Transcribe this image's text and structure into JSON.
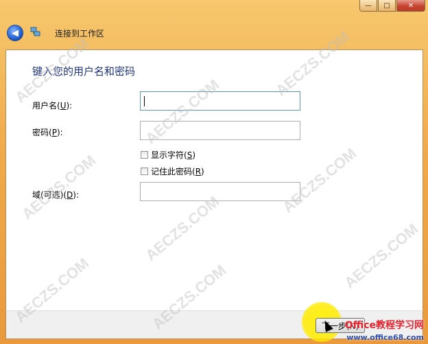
{
  "window": {
    "title_buttons": {
      "minimize": "—",
      "maximize": "□",
      "close": "✕"
    },
    "nav_title": "连接到工作区"
  },
  "form": {
    "heading": "键入您的用户名和密码",
    "username_label": "用户名(",
    "username_key": "U",
    "username_suffix": "):",
    "password_label": "密码(",
    "password_key": "P",
    "password_suffix": "):",
    "show_chars_label": "显示字符(",
    "show_chars_key": "S",
    "show_chars_suffix": ")",
    "remember_label": "记住此密码(",
    "remember_key": "R",
    "remember_suffix": ")",
    "domain_label": "域(可选)(",
    "domain_key": "D",
    "domain_suffix": "):",
    "username_value": "",
    "password_value": "",
    "domain_value": ""
  },
  "footer": {
    "next_button": "下一步(N)"
  },
  "watermark": {
    "brand": "Office教程学习网",
    "url": "www.office68.com",
    "diag_text": "AECZS.COM"
  }
}
